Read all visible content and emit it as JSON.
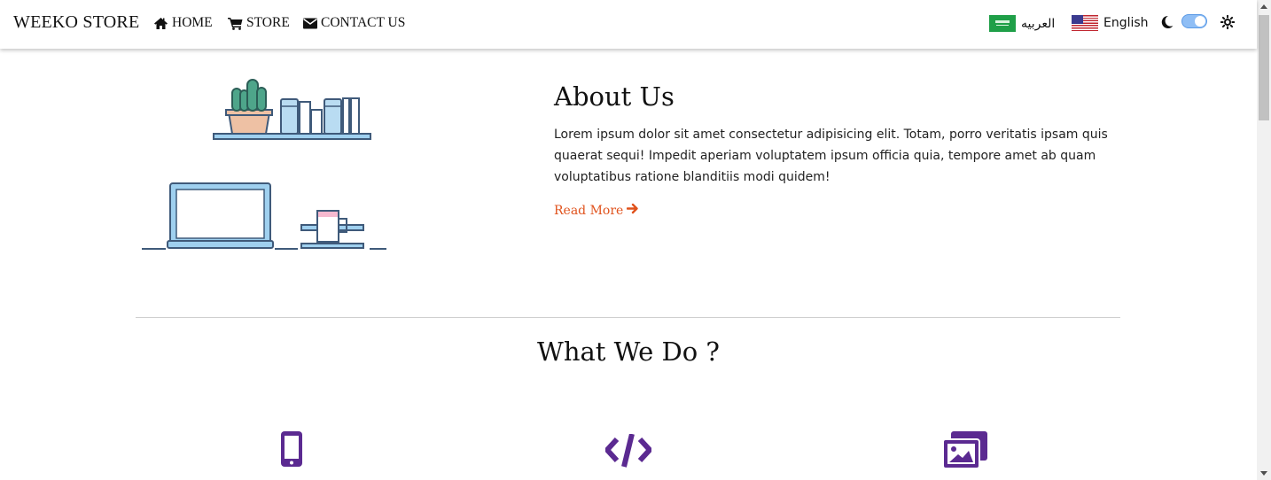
{
  "nav": {
    "brand": "WEEKO STORE",
    "links": [
      {
        "label": "HOME",
        "icon": "home-icon"
      },
      {
        "label": "STORE",
        "icon": "cart-icon"
      },
      {
        "label": "CONTACT US",
        "icon": "envelope-icon"
      }
    ],
    "languages": [
      {
        "label": "العربيه",
        "flag": "saudi-flag-icon"
      },
      {
        "label": "English",
        "flag": "us-flag-icon"
      }
    ],
    "theme_toggle": {
      "state": "on",
      "icons": [
        "moon-icon",
        "sun-icon"
      ]
    }
  },
  "about": {
    "title": "About Us",
    "text": "Lorem ipsum dolor sit amet consectetur adipisicing elit. Totam, porro veritatis ipsam quis quaerat sequi! Impedit aperiam voluptatem ipsum officia quia, tempore amet ab quam voluptatibus ratione blanditiis modi quidem!",
    "read_more": "Read More"
  },
  "what_we_do": {
    "title": "What We Do ?",
    "features": [
      {
        "icon": "mobile-icon"
      },
      {
        "icon": "code-icon"
      },
      {
        "icon": "images-icon"
      }
    ]
  },
  "colors": {
    "accent": "#e0521c",
    "feature_icon": "#5b2a91",
    "toggle": "#8fbef5"
  }
}
